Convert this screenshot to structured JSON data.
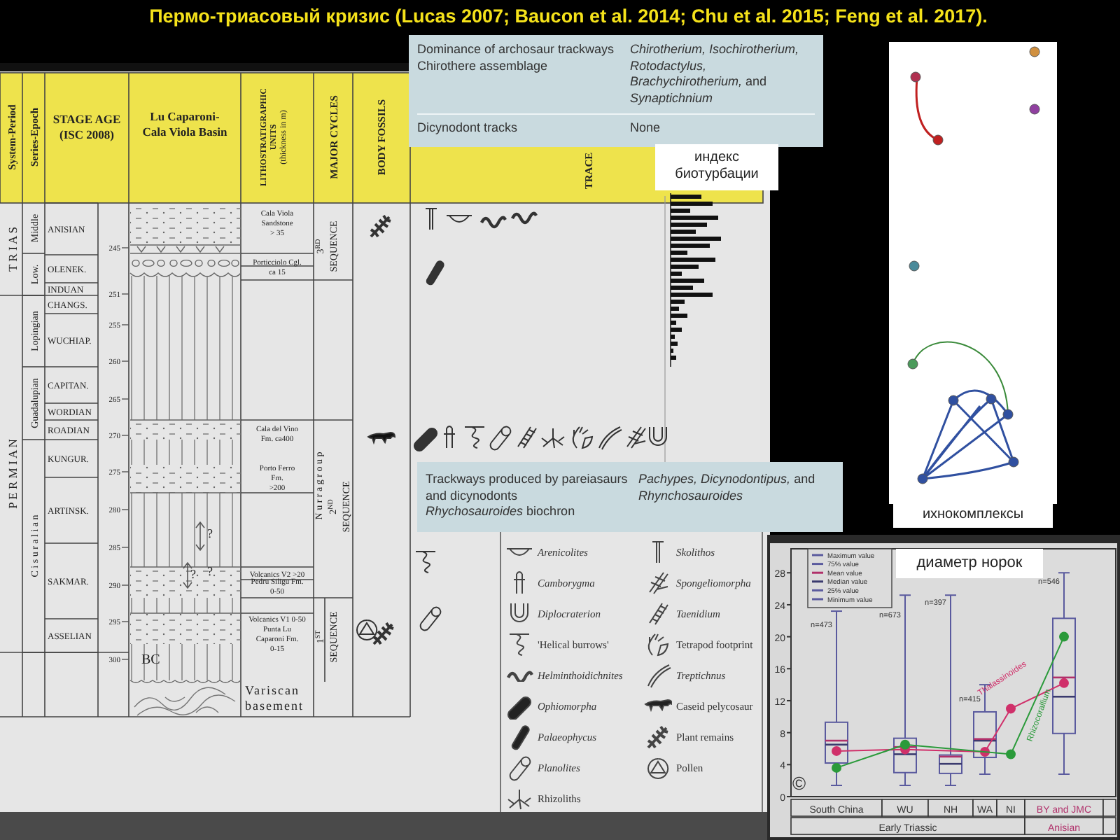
{
  "title": "Пермо-триасовый кризис (Lucas 2007; Baucon et al. 2014; Chu et al. 2015; Feng et al. 2017).",
  "strat_chart": {
    "headers": {
      "system": "System-Period",
      "series": "Series-Epoch",
      "stage": [
        "STAGE  AGE",
        "(ISC 2008)"
      ],
      "basin": [
        "Lu Caparoni-",
        "Cala Viola Basin"
      ],
      "litho": [
        "LITHOSTRATIGRAPHIC",
        "UNITS",
        "(thickness in m)"
      ],
      "cycles": "MAJOR CYCLES",
      "body": "BODY FOSSILS",
      "traces": "TRACE"
    },
    "systems": [
      "T R I A S",
      "P E R M I A N"
    ],
    "series": [
      "Middle",
      "Low.",
      "Lopingian",
      "Guadalupian",
      "C i s u r a l i a n"
    ],
    "stages": [
      "ANISIAN",
      "OLENEK.",
      "INDUAN",
      "CHANGS.",
      "WUCHIAP.",
      "CAPITAN.",
      "WORDIAN",
      "ROADIAN",
      "KUNGUR.",
      "ARTINSK.",
      "SAKMAR.",
      "ASSELIAN"
    ],
    "ages": [
      "245",
      "251",
      "255",
      "260",
      "265",
      "270",
      "275",
      "280",
      "285",
      "290",
      "295",
      "300"
    ],
    "units": [
      [
        "Cala Viola",
        "Sandstone",
        "> 35"
      ],
      [
        "Porticciolo Cgl.",
        "ca 15"
      ],
      [
        "Cala del Vino",
        "Fm. ca400"
      ],
      [
        "Porto Ferro",
        "Fm.",
        ">200"
      ],
      [
        "Volcanics V2 >20"
      ],
      [
        "Pedru Siligu Fm.",
        "0-50"
      ],
      [
        "Volcanics V1 0-50"
      ],
      [
        "Punta Lu",
        "Caparoni Fm.",
        "0-15"
      ]
    ],
    "question_marks": [
      "?",
      "?",
      "?"
    ],
    "bc_label": "BC",
    "basement": [
      "Variscan",
      "basement"
    ],
    "sequences": [
      {
        "number": "3",
        "suffix": "RD",
        "word": "SEQUENCE"
      },
      {
        "group": "N u r r a   g r o u p",
        "number": "2",
        "suffix": "ND",
        "word": "SEQUENCE"
      },
      {
        "number": "1",
        "suffix": "ST",
        "word": "SEQUENCE"
      }
    ]
  },
  "info_top": {
    "rows": [
      {
        "description": [
          "Dominance of archosaur trackways",
          "Chirothere assemblage"
        ],
        "ichnotaxa": "*Chirotherium, Isochirotherium, Rotodactylus, Brachychirotherium,* and *Synaptichnium*"
      },
      {
        "description": [
          "Dicynodont tracks"
        ],
        "ichnotaxa": "None"
      }
    ]
  },
  "info_bottom": {
    "rows": [
      {
        "description": [
          "Trackways produced by pareiasaurs and dicynodonts",
          "*Rhychosauroides* biochron"
        ],
        "ichnotaxa": "*Pachypes, Dicynodontipus,* and *Rhynchosauroides*"
      }
    ]
  },
  "bioturbation_label": "индекс биотурбации",
  "ichno_label": "ихнокомплексы",
  "legend": {
    "left": [
      {
        "name": "Arenicolites",
        "italic": true
      },
      {
        "name": "Camborygma",
        "italic": true
      },
      {
        "name": "Diplocraterion",
        "italic": true
      },
      {
        "name": "'Helical burrows'",
        "italic": false
      },
      {
        "name": "Helminthoidichnites",
        "italic": true
      },
      {
        "name": "Ophiomorpha",
        "italic": true
      },
      {
        "name": "Palaeophycus",
        "italic": true
      },
      {
        "name": "Planolites",
        "italic": true
      },
      {
        "name": "Rhizoliths",
        "italic": false
      }
    ],
    "right": [
      {
        "name": "Skolithos",
        "italic": true
      },
      {
        "name": "Spongeliomorpha",
        "italic": true
      },
      {
        "name": "Taenidium",
        "italic": true
      },
      {
        "name": "Tetrapod footprint",
        "italic": false
      },
      {
        "name": "Treptichnus",
        "italic": true
      },
      {
        "name": "Caseid pelycosaur",
        "italic": false
      },
      {
        "name": "Plant remains",
        "italic": false
      },
      {
        "name": "Pollen",
        "italic": false
      }
    ]
  },
  "burrow_chart": {
    "label": "диаметр норок",
    "copyright": "©",
    "box_legend": [
      "Maximum value",
      "75% value",
      "Mean value",
      "Median value",
      "25% value",
      "Minimum value"
    ],
    "x_groups": [
      {
        "label": "Early Triassic",
        "color": "#333333"
      },
      {
        "label": "Anisian",
        "color": "#b0306a"
      }
    ],
    "chart_data": {
      "type": "line",
      "categories": [
        "South China",
        "WU",
        "NH",
        "WA",
        "NI",
        "BY and JMC"
      ],
      "ylim": [
        0,
        31
      ],
      "yticks": [
        0,
        4,
        8,
        12,
        16,
        20,
        24,
        28
      ],
      "series": [
        {
          "name": "Thalassinoides",
          "color": "#d0306a",
          "marker": "circle",
          "values": [
            5.7,
            5.9,
            null,
            5.6,
            11,
            14.2
          ]
        },
        {
          "name": "Rhizocorallium",
          "color": "#2a9a3a",
          "marker": "circle",
          "values": [
            3.6,
            6.5,
            null,
            null,
            5.3,
            20
          ]
        }
      ],
      "annotations": [
        "n=473",
        "n=673",
        "n=397",
        "n=415",
        "n=546"
      ]
    }
  }
}
